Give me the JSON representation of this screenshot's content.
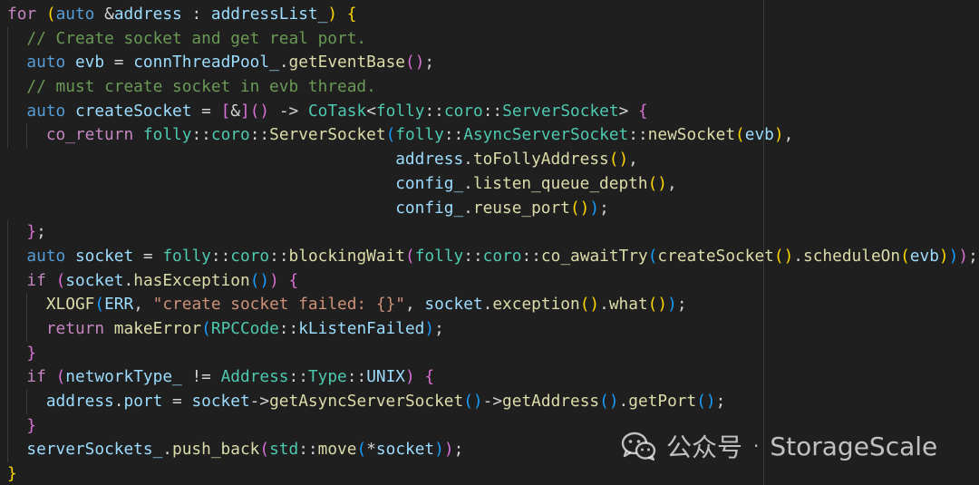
{
  "code": {
    "lines": [
      [
        {
          "t": "for",
          "c": "k"
        },
        {
          "t": " ",
          "c": "pn"
        },
        {
          "t": "(",
          "c": "br1"
        },
        {
          "t": "auto",
          "c": "kw"
        },
        {
          "t": " &",
          "c": "pn"
        },
        {
          "t": "address",
          "c": "nm"
        },
        {
          "t": " : ",
          "c": "pn"
        },
        {
          "t": "addressList_",
          "c": "nm"
        },
        {
          "t": ")",
          "c": "br1"
        },
        {
          "t": " {",
          "c": "br1"
        }
      ],
      [
        {
          "t": "  ",
          "c": "pn"
        },
        {
          "t": "// Create socket and get real port.",
          "c": "cm"
        }
      ],
      [
        {
          "t": "  ",
          "c": "pn"
        },
        {
          "t": "auto",
          "c": "kw"
        },
        {
          "t": " ",
          "c": "pn"
        },
        {
          "t": "evb",
          "c": "nm"
        },
        {
          "t": " = ",
          "c": "pn"
        },
        {
          "t": "connThreadPool_",
          "c": "nm"
        },
        {
          "t": ".",
          "c": "pn"
        },
        {
          "t": "getEventBase",
          "c": "fn"
        },
        {
          "t": "()",
          "c": "br2"
        },
        {
          "t": ";",
          "c": "pn"
        }
      ],
      [
        {
          "t": "  ",
          "c": "pn"
        },
        {
          "t": "// must create socket in evb thread.",
          "c": "cm"
        }
      ],
      [
        {
          "t": "  ",
          "c": "pn"
        },
        {
          "t": "auto",
          "c": "kw"
        },
        {
          "t": " ",
          "c": "pn"
        },
        {
          "t": "createSocket",
          "c": "nm"
        },
        {
          "t": " = ",
          "c": "pn"
        },
        {
          "t": "[",
          "c": "br2"
        },
        {
          "t": "&",
          "c": "pn"
        },
        {
          "t": "]",
          "c": "br2"
        },
        {
          "t": "()",
          "c": "br2"
        },
        {
          "t": " -> ",
          "c": "pn"
        },
        {
          "t": "CoTask",
          "c": "ty"
        },
        {
          "t": "<",
          "c": "pn"
        },
        {
          "t": "folly",
          "c": "ty"
        },
        {
          "t": "::",
          "c": "pn"
        },
        {
          "t": "coro",
          "c": "ty"
        },
        {
          "t": "::",
          "c": "pn"
        },
        {
          "t": "ServerSocket",
          "c": "ty"
        },
        {
          "t": ">",
          "c": "pn"
        },
        {
          "t": " {",
          "c": "br2"
        }
      ],
      [
        {
          "t": "    ",
          "c": "pn"
        },
        {
          "t": "co_return",
          "c": "k"
        },
        {
          "t": " ",
          "c": "pn"
        },
        {
          "t": "folly",
          "c": "ty"
        },
        {
          "t": "::",
          "c": "pn"
        },
        {
          "t": "coro",
          "c": "ty"
        },
        {
          "t": "::",
          "c": "pn"
        },
        {
          "t": "ServerSocket",
          "c": "fn"
        },
        {
          "t": "(",
          "c": "br3"
        },
        {
          "t": "folly",
          "c": "ty"
        },
        {
          "t": "::",
          "c": "pn"
        },
        {
          "t": "AsyncServerSocket",
          "c": "ty"
        },
        {
          "t": "::",
          "c": "pn"
        },
        {
          "t": "newSocket",
          "c": "fn"
        },
        {
          "t": "(",
          "c": "br1"
        },
        {
          "t": "evb",
          "c": "nm"
        },
        {
          "t": ")",
          "c": "br1"
        },
        {
          "t": ",",
          "c": "pn"
        }
      ],
      [
        {
          "t": "                                        ",
          "c": "pn"
        },
        {
          "t": "address",
          "c": "nm"
        },
        {
          "t": ".",
          "c": "pn"
        },
        {
          "t": "toFollyAddress",
          "c": "fn"
        },
        {
          "t": "()",
          "c": "br1"
        },
        {
          "t": ",",
          "c": "pn"
        }
      ],
      [
        {
          "t": "                                        ",
          "c": "pn"
        },
        {
          "t": "config_",
          "c": "nm"
        },
        {
          "t": ".",
          "c": "pn"
        },
        {
          "t": "listen_queue_depth",
          "c": "fn"
        },
        {
          "t": "()",
          "c": "br1"
        },
        {
          "t": ",",
          "c": "pn"
        }
      ],
      [
        {
          "t": "                                        ",
          "c": "pn"
        },
        {
          "t": "config_",
          "c": "nm"
        },
        {
          "t": ".",
          "c": "pn"
        },
        {
          "t": "reuse_port",
          "c": "fn"
        },
        {
          "t": "()",
          "c": "br1"
        },
        {
          "t": ")",
          "c": "br3"
        },
        {
          "t": ";",
          "c": "pn"
        }
      ],
      [
        {
          "t": "  ",
          "c": "pn"
        },
        {
          "t": "}",
          "c": "br2"
        },
        {
          "t": ";",
          "c": "pn"
        }
      ],
      [
        {
          "t": "  ",
          "c": "pn"
        },
        {
          "t": "auto",
          "c": "kw"
        },
        {
          "t": " ",
          "c": "pn"
        },
        {
          "t": "socket",
          "c": "nm"
        },
        {
          "t": " = ",
          "c": "pn"
        },
        {
          "t": "folly",
          "c": "ty"
        },
        {
          "t": "::",
          "c": "pn"
        },
        {
          "t": "coro",
          "c": "ty"
        },
        {
          "t": "::",
          "c": "pn"
        },
        {
          "t": "blockingWait",
          "c": "fn"
        },
        {
          "t": "(",
          "c": "br2"
        },
        {
          "t": "folly",
          "c": "ty"
        },
        {
          "t": "::",
          "c": "pn"
        },
        {
          "t": "coro",
          "c": "ty"
        },
        {
          "t": "::",
          "c": "pn"
        },
        {
          "t": "co_awaitTry",
          "c": "fn"
        },
        {
          "t": "(",
          "c": "br3"
        },
        {
          "t": "createSocket",
          "c": "fn"
        },
        {
          "t": "()",
          "c": "br1"
        },
        {
          "t": ".",
          "c": "pn"
        },
        {
          "t": "scheduleOn",
          "c": "fn"
        },
        {
          "t": "(",
          "c": "br1"
        },
        {
          "t": "evb",
          "c": "nm"
        },
        {
          "t": ")",
          "c": "br1"
        },
        {
          "t": ")",
          "c": "br3"
        },
        {
          "t": ")",
          "c": "br2"
        },
        {
          "t": ";",
          "c": "pn"
        }
      ],
      [
        {
          "t": "  ",
          "c": "pn"
        },
        {
          "t": "if",
          "c": "k"
        },
        {
          "t": " ",
          "c": "pn"
        },
        {
          "t": "(",
          "c": "br2"
        },
        {
          "t": "socket",
          "c": "nm"
        },
        {
          "t": ".",
          "c": "pn"
        },
        {
          "t": "hasException",
          "c": "fn"
        },
        {
          "t": "()",
          "c": "br3"
        },
        {
          "t": ")",
          "c": "br2"
        },
        {
          "t": " {",
          "c": "br2"
        }
      ],
      [
        {
          "t": "    ",
          "c": "pn"
        },
        {
          "t": "XLOGF",
          "c": "fn"
        },
        {
          "t": "(",
          "c": "br3"
        },
        {
          "t": "ERR",
          "c": "nm"
        },
        {
          "t": ", ",
          "c": "pn"
        },
        {
          "t": "\"create socket failed: {}\"",
          "c": "st"
        },
        {
          "t": ", ",
          "c": "pn"
        },
        {
          "t": "socket",
          "c": "nm"
        },
        {
          "t": ".",
          "c": "pn"
        },
        {
          "t": "exception",
          "c": "fn"
        },
        {
          "t": "()",
          "c": "br1"
        },
        {
          "t": ".",
          "c": "pn"
        },
        {
          "t": "what",
          "c": "fn"
        },
        {
          "t": "()",
          "c": "br1"
        },
        {
          "t": ")",
          "c": "br3"
        },
        {
          "t": ";",
          "c": "pn"
        }
      ],
      [
        {
          "t": "    ",
          "c": "pn"
        },
        {
          "t": "return",
          "c": "k"
        },
        {
          "t": " ",
          "c": "pn"
        },
        {
          "t": "makeError",
          "c": "fn"
        },
        {
          "t": "(",
          "c": "br3"
        },
        {
          "t": "RPCCode",
          "c": "ty"
        },
        {
          "t": "::",
          "c": "pn"
        },
        {
          "t": "kListenFailed",
          "c": "nm"
        },
        {
          "t": ")",
          "c": "br3"
        },
        {
          "t": ";",
          "c": "pn"
        }
      ],
      [
        {
          "t": "  ",
          "c": "pn"
        },
        {
          "t": "}",
          "c": "br2"
        }
      ],
      [
        {
          "t": "  ",
          "c": "pn"
        },
        {
          "t": "if",
          "c": "k"
        },
        {
          "t": " ",
          "c": "pn"
        },
        {
          "t": "(",
          "c": "br2"
        },
        {
          "t": "networkType_",
          "c": "nm"
        },
        {
          "t": " != ",
          "c": "pn"
        },
        {
          "t": "Address",
          "c": "ty"
        },
        {
          "t": "::",
          "c": "pn"
        },
        {
          "t": "Type",
          "c": "ty"
        },
        {
          "t": "::",
          "c": "pn"
        },
        {
          "t": "UNIX",
          "c": "nm"
        },
        {
          "t": ")",
          "c": "br2"
        },
        {
          "t": " {",
          "c": "br2"
        }
      ],
      [
        {
          "t": "    ",
          "c": "pn"
        },
        {
          "t": "address",
          "c": "nm"
        },
        {
          "t": ".",
          "c": "pn"
        },
        {
          "t": "port",
          "c": "nm"
        },
        {
          "t": " = ",
          "c": "pn"
        },
        {
          "t": "socket",
          "c": "nm"
        },
        {
          "t": "->",
          "c": "pn"
        },
        {
          "t": "getAsyncServerSocket",
          "c": "fn"
        },
        {
          "t": "()",
          "c": "br3"
        },
        {
          "t": "->",
          "c": "pn"
        },
        {
          "t": "getAddress",
          "c": "fn"
        },
        {
          "t": "()",
          "c": "br3"
        },
        {
          "t": ".",
          "c": "pn"
        },
        {
          "t": "getPort",
          "c": "fn"
        },
        {
          "t": "()",
          "c": "br3"
        },
        {
          "t": ";",
          "c": "pn"
        }
      ],
      [
        {
          "t": "  ",
          "c": "pn"
        },
        {
          "t": "}",
          "c": "br2"
        }
      ],
      [
        {
          "t": "  ",
          "c": "pn"
        },
        {
          "t": "serverSockets_",
          "c": "nm"
        },
        {
          "t": ".",
          "c": "pn"
        },
        {
          "t": "push_back",
          "c": "fn"
        },
        {
          "t": "(",
          "c": "br2"
        },
        {
          "t": "std",
          "c": "ty"
        },
        {
          "t": "::",
          "c": "pn"
        },
        {
          "t": "move",
          "c": "fn"
        },
        {
          "t": "(",
          "c": "br3"
        },
        {
          "t": "*",
          "c": "pn"
        },
        {
          "t": "socket",
          "c": "nm"
        },
        {
          "t": ")",
          "c": "br3"
        },
        {
          "t": ")",
          "c": "br2"
        },
        {
          "t": ";",
          "c": "pn"
        }
      ],
      [
        {
          "t": "}",
          "c": "br1"
        }
      ]
    ]
  },
  "colors": {
    "background": "#1f1f1f",
    "keyword_control": "#c586c0",
    "keyword": "#569cd6",
    "function": "#dcdcaa",
    "type": "#4ec9b0",
    "variable": "#9cdcfe",
    "string": "#ce9178",
    "comment": "#6a9955"
  },
  "watermark": {
    "icon": "wechat-icon",
    "label": "公众号",
    "separator": "·",
    "brand": "StorageScale"
  }
}
